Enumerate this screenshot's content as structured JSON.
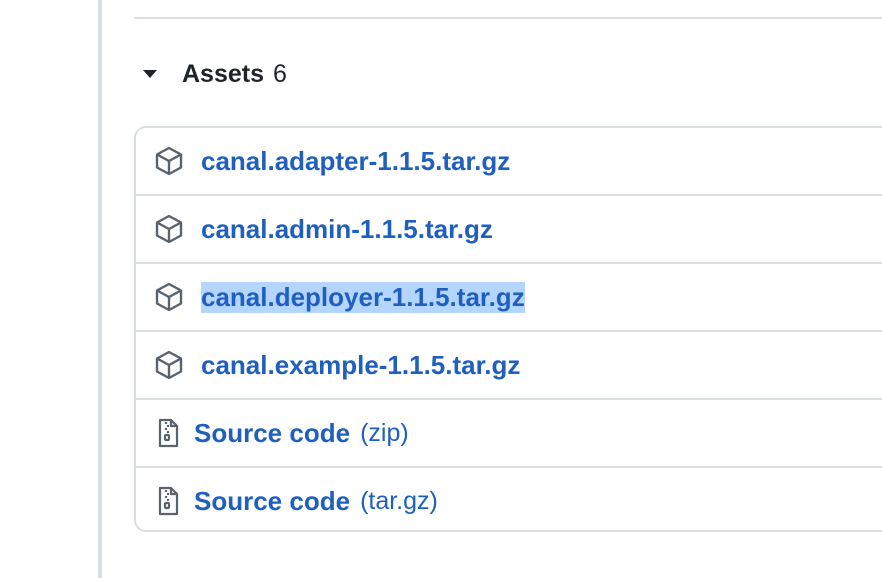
{
  "assets": {
    "title": "Assets",
    "count": "6",
    "toggle_icon": "triangle-down-icon",
    "items": [
      {
        "label": "canal.adapter-1.1.5.tar.gz",
        "icon": "package-icon"
      },
      {
        "label": "canal.admin-1.1.5.tar.gz",
        "icon": "package-icon"
      },
      {
        "label": "canal.deployer-1.1.5.tar.gz",
        "icon": "package-icon",
        "selected": true
      },
      {
        "label": "canal.example-1.1.5.tar.gz",
        "icon": "package-icon"
      }
    ],
    "source_items": [
      {
        "label": "Source code",
        "suffix": "(zip)",
        "icon": "file-zip-icon"
      },
      {
        "label": "Source code",
        "suffix": "(tar.gz)",
        "icon": "file-zip-icon"
      }
    ]
  },
  "colors": {
    "link": "#1f5fbf",
    "border": "#d8dee4",
    "selection": "#b4d5fe",
    "text": "#1f2328",
    "icon": "#59636e"
  }
}
